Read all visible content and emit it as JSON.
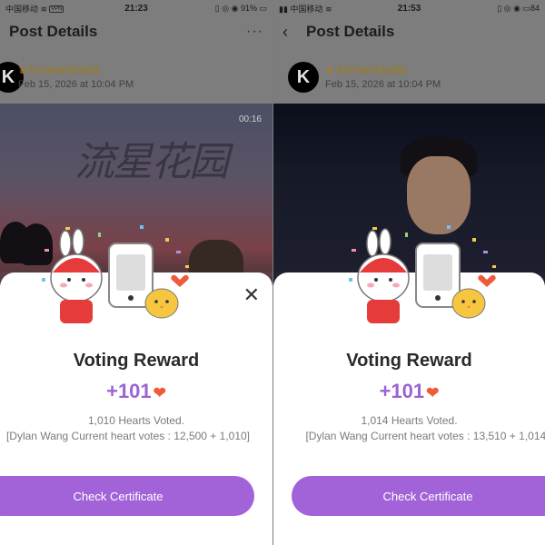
{
  "panels": [
    {
      "status": {
        "carrier": "中国移动",
        "vpn": "VPN",
        "time": "21:23",
        "battery": "91%"
      },
      "nav": {
        "title": "Post Details",
        "more": "···"
      },
      "author": {
        "name": "koreanizada",
        "date": "Feb 15, 2026 at 10:04 PM",
        "avatar_letter": "K"
      },
      "media": {
        "video_time": "00:16",
        "title_text": "流星花园"
      },
      "reward": {
        "title": "Voting Reward",
        "amount": "+101",
        "voted": "1,010 Hearts Voted.",
        "current": "[Dylan Wang Current heart votes : 12,500 + 1,010]",
        "button": "Check Certificate"
      }
    },
    {
      "status": {
        "carrier": "中国移动",
        "time": "21:53",
        "battery": "84"
      },
      "nav": {
        "title": "Post Details",
        "back": "‹"
      },
      "author": {
        "name": "koreanizada",
        "date": "Feb 15, 2026 at 10:04 PM",
        "avatar_letter": "K"
      },
      "media": {},
      "reward": {
        "title": "Voting Reward",
        "amount": "+101",
        "voted": "1,014 Hearts Voted.",
        "current": "[Dylan Wang Current heart votes : 13,510 + 1,014]",
        "button": "Check Certificate"
      }
    }
  ],
  "colors": {
    "accent": "#a263d8",
    "amount": "#9b63d3",
    "heart": "#ef5b3a",
    "author": "#b38a24"
  },
  "icons": [
    "wifi-icon",
    "signal-icon",
    "battery-icon",
    "back-icon",
    "more-icon",
    "close-icon",
    "heart-icon",
    "crown-icon"
  ]
}
